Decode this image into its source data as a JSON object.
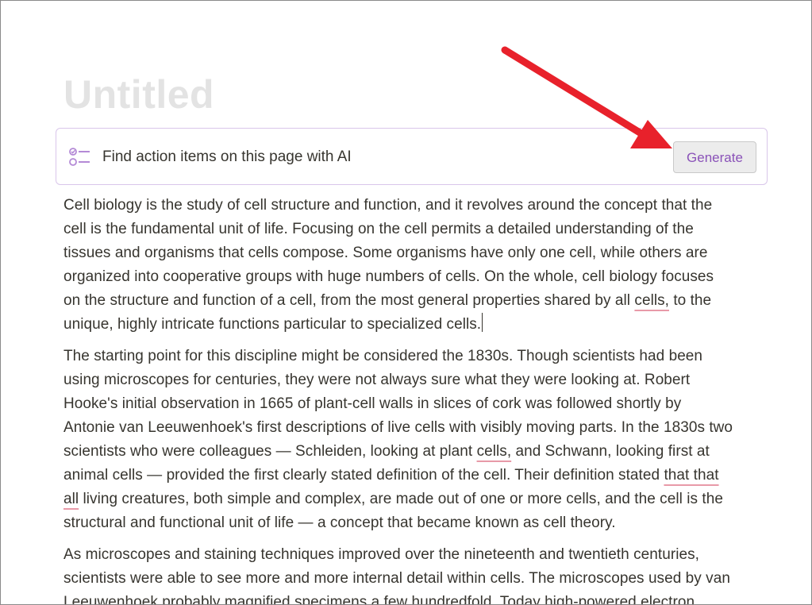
{
  "page": {
    "title": "Untitled"
  },
  "ai_bar": {
    "icon": "checklist-icon",
    "prompt": "Find action items on this page with AI",
    "button_label": "Generate"
  },
  "colors": {
    "accent": "#8a52b8",
    "arrow": "#e8212b",
    "spellcheck": "#e89aa8",
    "title_placeholder": "#e3e3e3",
    "text": "#37352f"
  },
  "paragraphs": [
    {
      "lines": [
        [
          "Cell biology is the study of cell structure and function, and it revolves around the concept that the"
        ],
        [
          "cell is the fundamental unit of life. Focusing on the cell permits a detailed understanding of the"
        ],
        [
          "tissues and organisms that cells compose. Some organisms have only one cell, while others are"
        ],
        [
          "organized into cooperative groups with huge numbers of cells. On the whole, cell biology focuses"
        ],
        [
          "on the structure and function of a cell, from the most general properties shared by all ",
          "cells,",
          " to the"
        ],
        [
          "unique, highly intricate functions particular to specialized cells."
        ]
      ]
    },
    {
      "lines": [
        [
          "The starting point for this discipline might be considered the 1830s. Though scientists had been"
        ],
        [
          "using microscopes for centuries, they were not always sure what they were looking at. Robert"
        ],
        [
          "Hooke's initial observation in 1665 of plant-cell walls in slices of cork was followed shortly by"
        ],
        [
          "Antonie van Leeuwenhoek's first descriptions of live cells with visibly moving parts. In the 1830s two"
        ],
        [
          "scientists who were colleagues — Schleiden, looking at plant ",
          "cells,",
          " and Schwann, looking first at"
        ],
        [
          "animal cells — provided the first clearly stated definition of the cell. Their definition stated ",
          "that that",
          ""
        ],
        [
          "",
          "all",
          " living creatures, both simple and complex, are made out of one or more cells, and the cell is the"
        ],
        [
          "structural and functional unit of life — a concept that became known as cell theory."
        ]
      ]
    },
    {
      "lines": [
        [
          "As microscopes and staining techniques improved over the nineteenth and twentieth centuries,"
        ],
        [
          "scientists were able to see more and more internal detail within cells. The microscopes used by van"
        ],
        [
          "Leeuwenhoek probably magnified specimens a few hundredfold. Today high-powered electron"
        ]
      ]
    }
  ]
}
